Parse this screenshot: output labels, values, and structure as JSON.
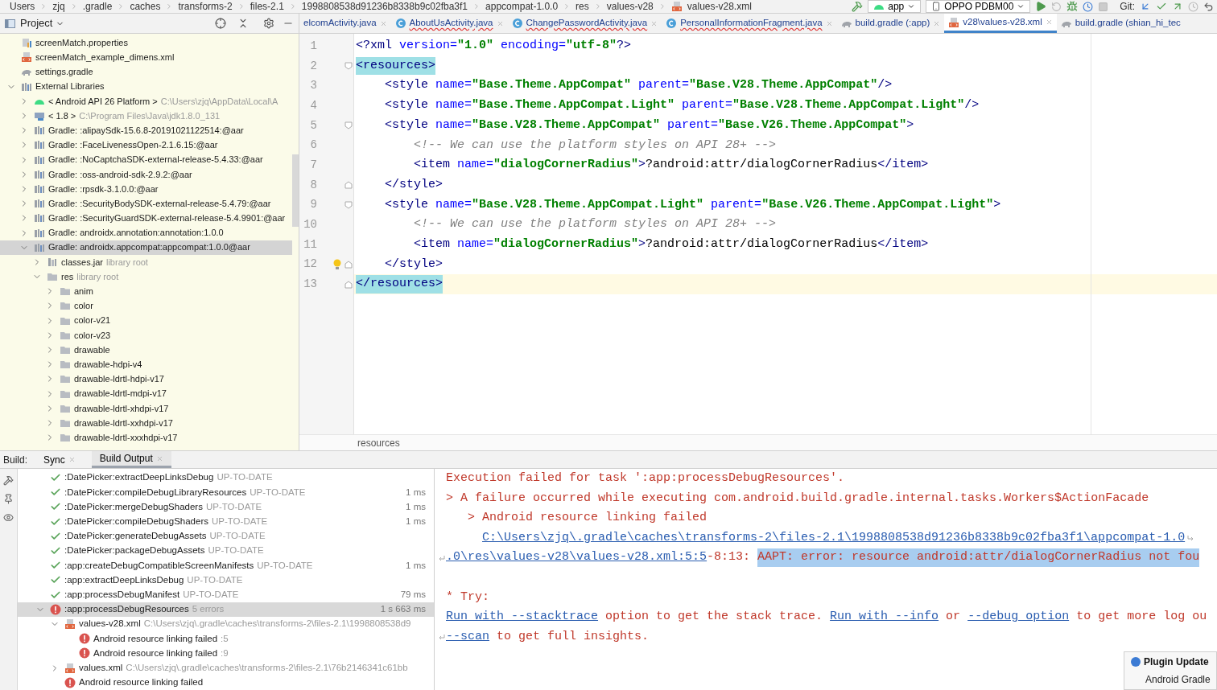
{
  "breadcrumbs": [
    "Users",
    "zjq",
    ".gradle",
    "caches",
    "transforms-2",
    "files-2.1",
    "1998808538d91236b8338b9c02fba3f1",
    "appcompat-1.0.0",
    "res",
    "values-v28",
    "values-v28.xml"
  ],
  "toolbar": {
    "run_config": "app",
    "device": "OPPO PDBM00",
    "vcs_label": "Git:"
  },
  "project": {
    "title": "Project",
    "tree": [
      {
        "kind": "properties",
        "label": "screenMatch.properties",
        "selected": false
      },
      {
        "kind": "xml",
        "label": "screenMatch_example_dimens.xml",
        "selected": false
      },
      {
        "kind": "gradle",
        "label": "settings.gradle",
        "selected": false
      },
      {
        "kind": "libraries",
        "label": "External Libraries",
        "expanded": true,
        "selected": false,
        "children": [
          {
            "kind": "android",
            "label": "< Android API 26 Platform >",
            "note": "C:\\Users\\zjq\\AppData\\Local\\A",
            "expanded": false,
            "selected": false
          },
          {
            "kind": "jdk",
            "label": "< 1.8 >",
            "note": "C:\\Program Files\\Java\\jdk1.8.0_131",
            "expanded": false,
            "selected": false
          },
          {
            "kind": "library",
            "label": "Gradle: :alipaySdk-15.6.8-20191021122514:@aar",
            "expanded": false,
            "selected": false
          },
          {
            "kind": "library",
            "label": "Gradle: :FaceLivenessOpen-2.1.6.15:@aar",
            "expanded": false,
            "selected": false
          },
          {
            "kind": "library",
            "label": "Gradle: :NoCaptchaSDK-external-release-5.4.33:@aar",
            "expanded": false,
            "selected": false
          },
          {
            "kind": "library",
            "label": "Gradle: :oss-android-sdk-2.9.2:@aar",
            "expanded": false,
            "selected": false
          },
          {
            "kind": "library",
            "label": "Gradle: :rpsdk-3.1.0.0:@aar",
            "expanded": false,
            "selected": false
          },
          {
            "kind": "library",
            "label": "Gradle: :SecurityBodySDK-external-release-5.4.79:@aar",
            "expanded": false,
            "selected": false
          },
          {
            "kind": "library",
            "label": "Gradle: :SecurityGuardSDK-external-release-5.4.9901:@aar",
            "expanded": false,
            "selected": false
          },
          {
            "kind": "library",
            "label": "Gradle: androidx.annotation:annotation:1.0.0",
            "expanded": false,
            "selected": false
          },
          {
            "kind": "library",
            "label": "Gradle: androidx.appcompat:appcompat:1.0.0@aar",
            "expanded": true,
            "selected": true,
            "children": [
              {
                "kind": "jar",
                "label": "classes.jar",
                "note": "library root",
                "expanded": false,
                "selected": false
              },
              {
                "kind": "folder",
                "label": "res",
                "note": "library root",
                "expanded": true,
                "selected": false,
                "children": [
                  {
                    "kind": "folder",
                    "label": "anim",
                    "expanded": false,
                    "selected": false
                  },
                  {
                    "kind": "folder",
                    "label": "color",
                    "expanded": false,
                    "selected": false
                  },
                  {
                    "kind": "folder",
                    "label": "color-v21",
                    "expanded": false,
                    "selected": false
                  },
                  {
                    "kind": "folder",
                    "label": "color-v23",
                    "expanded": false,
                    "selected": false
                  },
                  {
                    "kind": "folder",
                    "label": "drawable",
                    "expanded": false,
                    "selected": false
                  },
                  {
                    "kind": "folder",
                    "label": "drawable-hdpi-v4",
                    "expanded": false,
                    "selected": false
                  },
                  {
                    "kind": "folder",
                    "label": "drawable-ldrtl-hdpi-v17",
                    "expanded": false,
                    "selected": false
                  },
                  {
                    "kind": "folder",
                    "label": "drawable-ldrtl-mdpi-v17",
                    "expanded": false,
                    "selected": false
                  },
                  {
                    "kind": "folder",
                    "label": "drawable-ldrtl-xhdpi-v17",
                    "expanded": false,
                    "selected": false
                  },
                  {
                    "kind": "folder",
                    "label": "drawable-ldrtl-xxhdpi-v17",
                    "expanded": false,
                    "selected": false
                  },
                  {
                    "kind": "folder",
                    "label": "drawable-ldrtl-xxxhdpi-v17",
                    "expanded": false,
                    "selected": false
                  }
                ]
              }
            ]
          }
        ]
      }
    ]
  },
  "tabs": [
    {
      "label": "elcomActivity.java",
      "selected": false,
      "error": false,
      "closable": true
    },
    {
      "kind": "java",
      "label": "AboutUsActivity.java",
      "selected": false,
      "error": true,
      "closable": true
    },
    {
      "kind": "java",
      "label": "ChangePasswordActivity.java",
      "selected": false,
      "error": true,
      "closable": true
    },
    {
      "kind": "java",
      "label": "PersonalInformationFragment.java",
      "selected": false,
      "error": true,
      "closable": true
    },
    {
      "kind": "gradle",
      "label": "build.gradle (:app)",
      "selected": false,
      "error": false,
      "closable": true
    },
    {
      "kind": "xml",
      "label": "v28\\values-v28.xml",
      "selected": true,
      "error": false,
      "closable": true
    },
    {
      "kind": "gradle",
      "label": "build.gradle (shian_hi_tec",
      "selected": false,
      "error": false,
      "closable": false
    }
  ],
  "editor": {
    "lines": [
      {
        "number": "1",
        "current": false,
        "tokens": [
          {
            "kind": "tag",
            "text": "<?xml "
          },
          {
            "kind": "attr",
            "text": "version="
          },
          {
            "kind": "value",
            "text": "\"1.0\" "
          },
          {
            "kind": "attr",
            "text": "encoding="
          },
          {
            "kind": "value",
            "text": "\"utf-8\""
          },
          {
            "kind": "tag",
            "text": "?>"
          }
        ]
      },
      {
        "number": "2",
        "current": false,
        "fold_start": true,
        "tokens": [
          {
            "kind": "matched",
            "text": "<resources>"
          }
        ]
      },
      {
        "number": "3",
        "current": false,
        "tokens": [
          {
            "kind": "tag",
            "text": "    <style "
          },
          {
            "kind": "attr",
            "text": "name="
          },
          {
            "kind": "value",
            "text": "\"Base.Theme.AppCompat\" "
          },
          {
            "kind": "attr",
            "text": "parent="
          },
          {
            "kind": "value",
            "text": "\"Base.V28.Theme.AppCompat\""
          },
          {
            "kind": "tag",
            "text": "/>"
          }
        ]
      },
      {
        "number": "4",
        "current": false,
        "tokens": [
          {
            "kind": "tag",
            "text": "    <style "
          },
          {
            "kind": "attr",
            "text": "name="
          },
          {
            "kind": "value",
            "text": "\"Base.Theme.AppCompat.Light\" "
          },
          {
            "kind": "attr",
            "text": "parent="
          },
          {
            "kind": "value",
            "text": "\"Base.V28.Theme.AppCompat.Light\""
          },
          {
            "kind": "tag",
            "text": "/>"
          }
        ]
      },
      {
        "number": "5",
        "current": false,
        "fold_start": true,
        "tokens": [
          {
            "kind": "tag",
            "text": "    <style "
          },
          {
            "kind": "attr",
            "text": "name="
          },
          {
            "kind": "value",
            "text": "\"Base.V28.Theme.AppCompat\" "
          },
          {
            "kind": "attr",
            "text": "parent="
          },
          {
            "kind": "value",
            "text": "\"Base.V26.Theme.AppCompat\""
          },
          {
            "kind": "tag",
            "text": ">"
          }
        ]
      },
      {
        "number": "6",
        "current": false,
        "tokens": [
          {
            "kind": "comment",
            "text": "        <!-- We can use the platform styles on API 28+ -->"
          }
        ]
      },
      {
        "number": "7",
        "current": false,
        "tokens": [
          {
            "kind": "tag",
            "text": "        <item "
          },
          {
            "kind": "attr",
            "text": "name="
          },
          {
            "kind": "value",
            "text": "\"dialogCornerRadius\""
          },
          {
            "kind": "tag",
            "text": ">"
          },
          {
            "kind": "text",
            "text": "?android:attr/dialogCornerRadius"
          },
          {
            "kind": "tag",
            "text": "</item>"
          }
        ]
      },
      {
        "number": "8",
        "current": false,
        "fold_end": true,
        "tokens": [
          {
            "kind": "tag",
            "text": "    </style>"
          }
        ]
      },
      {
        "number": "9",
        "current": false,
        "fold_start": true,
        "tokens": [
          {
            "kind": "tag",
            "text": "    <style "
          },
          {
            "kind": "attr",
            "text": "name="
          },
          {
            "kind": "value",
            "text": "\"Base.V28.Theme.AppCompat.Light\" "
          },
          {
            "kind": "attr",
            "text": "parent="
          },
          {
            "kind": "value",
            "text": "\"Base.V26.Theme.AppCompat.Light\""
          },
          {
            "kind": "tag",
            "text": ">"
          }
        ]
      },
      {
        "number": "10",
        "current": false,
        "tokens": [
          {
            "kind": "comment",
            "text": "        <!-- We can use the platform styles on API 28+ -->"
          }
        ]
      },
      {
        "number": "11",
        "current": false,
        "tokens": [
          {
            "kind": "tag",
            "text": "        <item "
          },
          {
            "kind": "attr",
            "text": "name="
          },
          {
            "kind": "value",
            "text": "\"dialogCornerRadius\""
          },
          {
            "kind": "tag",
            "text": ">"
          },
          {
            "kind": "text",
            "text": "?android:attr/dialogCornerRadius"
          },
          {
            "kind": "tag",
            "text": "</item>"
          }
        ]
      },
      {
        "number": "12",
        "current": false,
        "fold_end": true,
        "bulb": true,
        "tokens": [
          {
            "kind": "tag",
            "text": "    </style>"
          }
        ]
      },
      {
        "number": "13",
        "current": true,
        "fold_end": true,
        "tokens": [
          {
            "kind": "matched",
            "text": "</resources>"
          }
        ]
      }
    ],
    "breadcrumb": "resources"
  },
  "build": {
    "title": "Build:",
    "tabs": [
      {
        "label": "Sync",
        "selected": false
      },
      {
        "label": "Build Output",
        "selected": true
      }
    ],
    "tree": [
      {
        "kind": "task",
        "failed": false,
        "label": ":DatePicker:extractDeepLinksDebug",
        "note": "UP-TO-DATE",
        "selected": false
      },
      {
        "kind": "task",
        "failed": false,
        "label": ":DatePicker:compileDebugLibraryResources",
        "note": "UP-TO-DATE",
        "time": "1 ms",
        "selected": false
      },
      {
        "kind": "task",
        "failed": false,
        "label": ":DatePicker:mergeDebugShaders",
        "note": "UP-TO-DATE",
        "time": "1 ms",
        "selected": false
      },
      {
        "kind": "task",
        "failed": false,
        "label": ":DatePicker:compileDebugShaders",
        "note": "UP-TO-DATE",
        "time": "1 ms",
        "selected": false
      },
      {
        "kind": "task",
        "failed": false,
        "label": ":DatePicker:generateDebugAssets",
        "note": "UP-TO-DATE",
        "selected": false
      },
      {
        "kind": "task",
        "failed": false,
        "label": ":DatePicker:packageDebugAssets",
        "note": "UP-TO-DATE",
        "selected": false
      },
      {
        "kind": "task",
        "failed": false,
        "label": ":app:createDebugCompatibleScreenManifests",
        "note": "UP-TO-DATE",
        "time": "1 ms",
        "selected": false
      },
      {
        "kind": "task",
        "failed": false,
        "label": ":app:extractDeepLinksDebug",
        "note": "UP-TO-DATE",
        "selected": false
      },
      {
        "kind": "task",
        "failed": false,
        "label": ":app:processDebugManifest",
        "note": "UP-TO-DATE",
        "time": "79 ms",
        "selected": false
      },
      {
        "kind": "task",
        "failed": true,
        "label": ":app:processDebugResources",
        "note": "5 errors",
        "time": "1 s 663 ms",
        "expanded": true,
        "selected": true,
        "children": [
          {
            "kind": "file",
            "label": "values-v28.xml",
            "note": "C:\\Users\\zjq\\.gradle\\caches\\transforms-2\\files-2.1\\1998808538d9",
            "expanded": true,
            "selected": false,
            "children": [
              {
                "kind": "task",
                "failed": true,
                "label": "Android resource linking failed",
                "note": ":5",
                "selected": false
              },
              {
                "kind": "task",
                "failed": true,
                "label": "Android resource linking failed",
                "note": ":9",
                "selected": false
              }
            ]
          },
          {
            "kind": "file",
            "label": "values.xml",
            "note": "C:\\Users\\zjq\\.gradle\\caches\\transforms-2\\files-2.1\\76b2146341c61bb",
            "expanded": false,
            "selected": false
          },
          {
            "kind": "task",
            "failed": true,
            "label": "Android resource linking failed",
            "selected": false
          }
        ]
      }
    ],
    "output": [
      {
        "segments": [
          {
            "kind": "text",
            "text": "Execution failed for task ':app:processDebugResources'."
          }
        ]
      },
      {
        "segments": [
          {
            "kind": "text",
            "text": "> A failure occurred while executing com.android.build.gradle.internal.tasks.Workers$ActionFacade"
          }
        ]
      },
      {
        "segments": [
          {
            "kind": "text",
            "text": "   > Android resource linking failed"
          }
        ]
      },
      {
        "indented": true,
        "wrap_end": true,
        "segments": [
          {
            "kind": "link",
            "text": "C:\\Users\\zjq\\.gradle\\caches\\transforms-2\\files-2.1\\1998808538d91236b8338b9c02fba3f1\\appcompat-1.0"
          }
        ]
      },
      {
        "wrap_start": true,
        "segments": [
          {
            "kind": "link",
            "text": ".0\\res\\values-v28\\values-v28.xml:5:5"
          },
          {
            "kind": "text",
            "text": "-8:13: "
          },
          {
            "kind": "highlight",
            "text": "AAPT: error: resource android:attr/dialogCornerRadius not fou"
          }
        ]
      },
      {
        "gap_before": true,
        "segments": [
          {
            "kind": "text",
            "text": "* Try:"
          }
        ]
      },
      {
        "segments": [
          {
            "kind": "link",
            "text": "Run with --stacktrace"
          },
          {
            "kind": "text",
            "text": " option to get the stack trace. "
          },
          {
            "kind": "link",
            "text": "Run with --info"
          },
          {
            "kind": "text",
            "text": " or "
          },
          {
            "kind": "link",
            "text": "--debug option"
          },
          {
            "kind": "text",
            "text": " to get more log ou"
          }
        ]
      },
      {
        "wrap_start": true,
        "segments": [
          {
            "kind": "link",
            "text": "--scan"
          },
          {
            "kind": "text",
            "text": " to get full insights."
          }
        ]
      }
    ]
  },
  "notification": {
    "title": "Plugin Update",
    "body": "Android Gradle"
  }
}
